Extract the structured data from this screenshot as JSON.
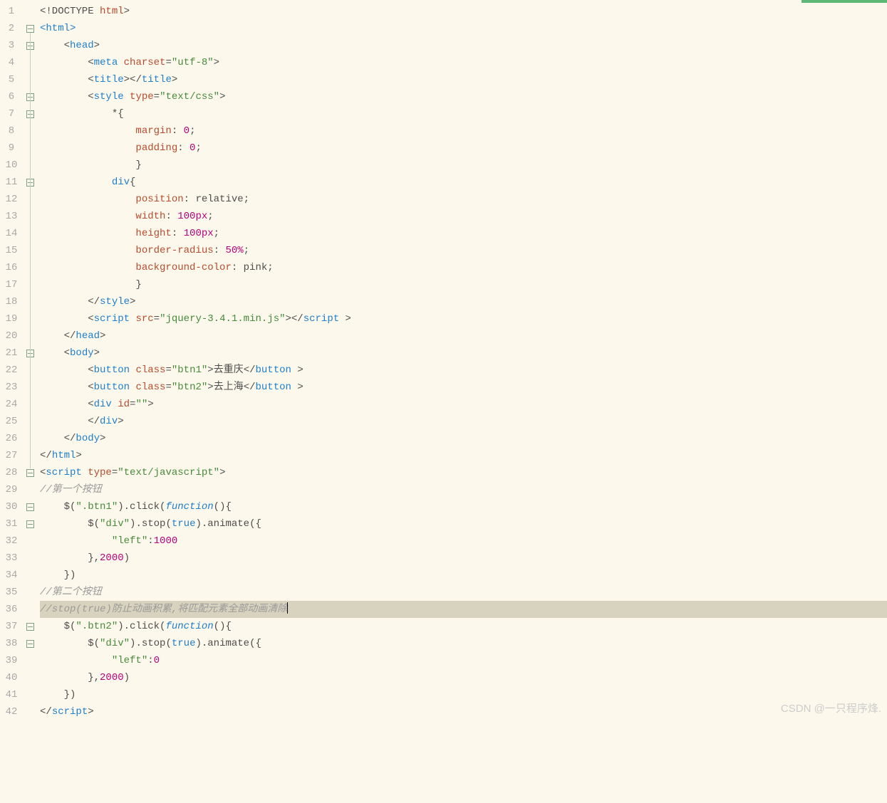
{
  "watermark": "CSDN @一只程序烽.",
  "lines": [
    {
      "n": 1
    },
    {
      "n": 2
    },
    {
      "n": 3
    },
    {
      "n": 4
    },
    {
      "n": 5
    },
    {
      "n": 6
    },
    {
      "n": 7
    },
    {
      "n": 8
    },
    {
      "n": 9
    },
    {
      "n": 10
    },
    {
      "n": 11
    },
    {
      "n": 12
    },
    {
      "n": 13
    },
    {
      "n": 14
    },
    {
      "n": 15
    },
    {
      "n": 16
    },
    {
      "n": 17
    },
    {
      "n": 18
    },
    {
      "n": 19
    },
    {
      "n": 20
    },
    {
      "n": 21
    },
    {
      "n": 22
    },
    {
      "n": 23
    },
    {
      "n": 24
    },
    {
      "n": 25
    },
    {
      "n": 26
    },
    {
      "n": 27
    },
    {
      "n": 28
    },
    {
      "n": 29
    },
    {
      "n": 30
    },
    {
      "n": 31
    },
    {
      "n": 32
    },
    {
      "n": 33
    },
    {
      "n": 34
    },
    {
      "n": 35
    },
    {
      "n": 36
    },
    {
      "n": 37
    },
    {
      "n": 38
    },
    {
      "n": 39
    },
    {
      "n": 40
    },
    {
      "n": 41
    },
    {
      "n": 42
    }
  ],
  "code": {
    "l1_doctype": "<!DOCTYPE ",
    "l1_html": "html",
    "l1_end": ">",
    "l2": "<html>",
    "l3_open": "<",
    "l3_tag": "head",
    "l3_close": ">",
    "l4_open": "<",
    "l4_tag": "meta ",
    "l4_attr": "charset",
    "l4_eq": "=",
    "l4_val": "\"utf-8\"",
    "l4_close": ">",
    "l5_a": "<",
    "l5_tag": "title",
    "l5_b": "></",
    "l5_c": ">",
    "l6_a": "<",
    "l6_tag": "style ",
    "l6_attr": "type",
    "l6_eq": "=",
    "l6_val": "\"text/css\"",
    "l6_b": ">",
    "l7_sel": "*",
    "l7_b": "{",
    "l8_prop": "margin",
    "l8_c": ": ",
    "l8_val": "0",
    "l8_s": ";",
    "l9_prop": "padding",
    "l9_c": ": ",
    "l9_val": "0",
    "l9_s": ";",
    "l10": "}",
    "l11_sel": "div",
    "l11_b": "{",
    "l12_prop": "position",
    "l12_c": ": relative;",
    "l13_prop": "width",
    "l13_c": ": ",
    "l13_val": "100px",
    "l13_s": ";",
    "l14_prop": "height",
    "l14_c": ": ",
    "l14_val": "100px",
    "l14_s": ";",
    "l15_prop": "border-radius",
    "l15_c": ": ",
    "l15_val": "50%",
    "l15_s": ";",
    "l16_prop": "background-color",
    "l16_c": ": pink;",
    "l17": "}",
    "l18_a": "</",
    "l18_tag": "style",
    "l18_b": ">",
    "l19_a": "<",
    "l19_tag": "script ",
    "l19_attr": "src",
    "l19_eq": "=",
    "l19_val": "\"jquery-3.4.1.min.js\"",
    "l19_b": "></",
    "l19_c": ">",
    "l20_a": "</",
    "l20_tag": "head",
    "l20_b": ">",
    "l21_a": "<",
    "l21_tag": "body",
    "l21_b": ">",
    "l22_a": "<",
    "l22_tag": "button ",
    "l22_attr": "class",
    "l22_eq": "=",
    "l22_val": "\"btn1\"",
    "l22_b": ">",
    "l22_txt": "去重庆",
    "l22_c": "</",
    "l22_d": ">",
    "l23_a": "<",
    "l23_tag": "button ",
    "l23_attr": "class",
    "l23_eq": "=",
    "l23_val": "\"btn2\"",
    "l23_b": ">",
    "l23_txt": "去上海",
    "l23_c": "</",
    "l23_d": ">",
    "l24_a": "<",
    "l24_tag": "div ",
    "l24_attr": "id",
    "l24_eq": "=",
    "l24_val": "\"\"",
    "l24_b": ">",
    "l25_a": "</",
    "l25_tag": "div",
    "l25_b": ">",
    "l26_a": "</",
    "l26_tag": "body",
    "l26_b": ">",
    "l27_a": "</",
    "l27_tag": "html",
    "l27_b": ">",
    "l28_a": "<",
    "l28_tag": "script ",
    "l28_attr": "type",
    "l28_eq": "=",
    "l28_val": "\"text/javascript\"",
    "l28_b": ">",
    "l29": "//第一个按钮",
    "l30_a": "$(",
    "l30_s1": "\".btn1\"",
    "l30_b": ").click(",
    "l30_fn": "function",
    "l30_c": "(){",
    "l31_a": "$(",
    "l31_s1": "\"div\"",
    "l31_b": ").stop(",
    "l31_t": "true",
    "l31_c": ").animate({",
    "l32_k": "\"left\"",
    "l32_c": ":",
    "l32_v": "1000",
    "l33_a": "},",
    "l33_v": "2000",
    "l33_b": ")",
    "l34": "})",
    "l35": "//第二个按钮",
    "l36": "//stop(true)防止动画积累,将匹配元素全部动画清除",
    "l37_a": "$(",
    "l37_s1": "\".btn2\"",
    "l37_b": ").click(",
    "l37_fn": "function",
    "l37_c": "(){",
    "l38_a": "$(",
    "l38_s1": "\"div\"",
    "l38_b": ").stop(",
    "l38_t": "true",
    "l38_c": ").animate({",
    "l39_k": "\"left\"",
    "l39_c": ":",
    "l39_v": "0",
    "l40_a": "},",
    "l40_v": "2000",
    "l40_b": ")",
    "l41": "})",
    "l42_a": "</",
    "l42_tag": "script",
    "l42_b": ">"
  }
}
